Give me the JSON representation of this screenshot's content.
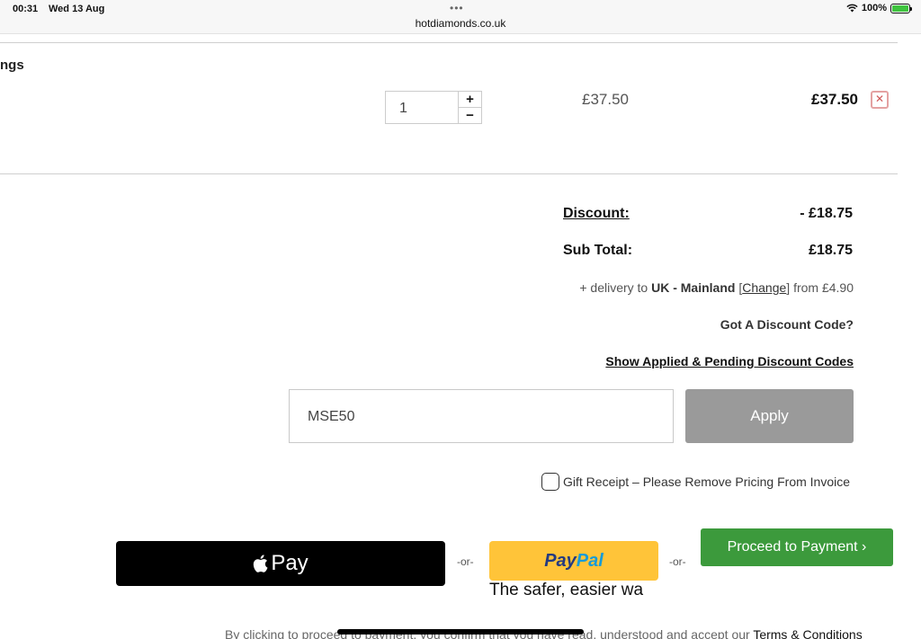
{
  "status_bar": {
    "time": "00:31",
    "date": "Wed 13 Aug",
    "dots": "•••",
    "url": "hotdiamonds.co.uk",
    "wifi_icon": "wifi-icon",
    "battery_percent": "100%",
    "battery_level": 1.0
  },
  "cart_item": {
    "title_fragment": "ngs",
    "quantity": "1",
    "plus_label": "+",
    "minus_label": "−",
    "unit_price": "£37.50",
    "line_total": "£37.50",
    "remove_icon": "close-icon",
    "remove_label": "✕"
  },
  "summary": {
    "discount_label": "Discount:",
    "discount_value": "- £18.75",
    "subtotal_label": "Sub Total:",
    "subtotal_value": "£18.75",
    "delivery_prefix": "+ delivery to ",
    "delivery_region": "UK - Mainland",
    "delivery_change_open": " [",
    "delivery_change": "Change",
    "delivery_change_close": "] ",
    "delivery_from": "from £4.90"
  },
  "discount": {
    "question": "Got A Discount Code?",
    "show_codes_link": "Show Applied & Pending Discount Codes",
    "code_value": "MSE50",
    "apply_label": "Apply"
  },
  "gift_receipt": {
    "label": "Gift Receipt – Please Remove Pricing From Invoice",
    "checked": false
  },
  "payment": {
    "apple_pay_label": "Pay",
    "or_1": "-or-",
    "paypal_pay": "Pay",
    "paypal_pal": "Pal",
    "paypal_tagline": "The safer, easier wa",
    "or_2": "-or-",
    "proceed_label": "Proceed to Payment ›"
  },
  "legal": {
    "text": "By clicking to proceed to payment, you confirm that you have read, understood and accept our ",
    "terms_link": "Terms & Conditions"
  },
  "colors": {
    "apply_button": "#9a9a9a",
    "proceed_button": "#3c9a3c",
    "paypal_button": "#ffc439",
    "remove_icon": "#d05858"
  }
}
